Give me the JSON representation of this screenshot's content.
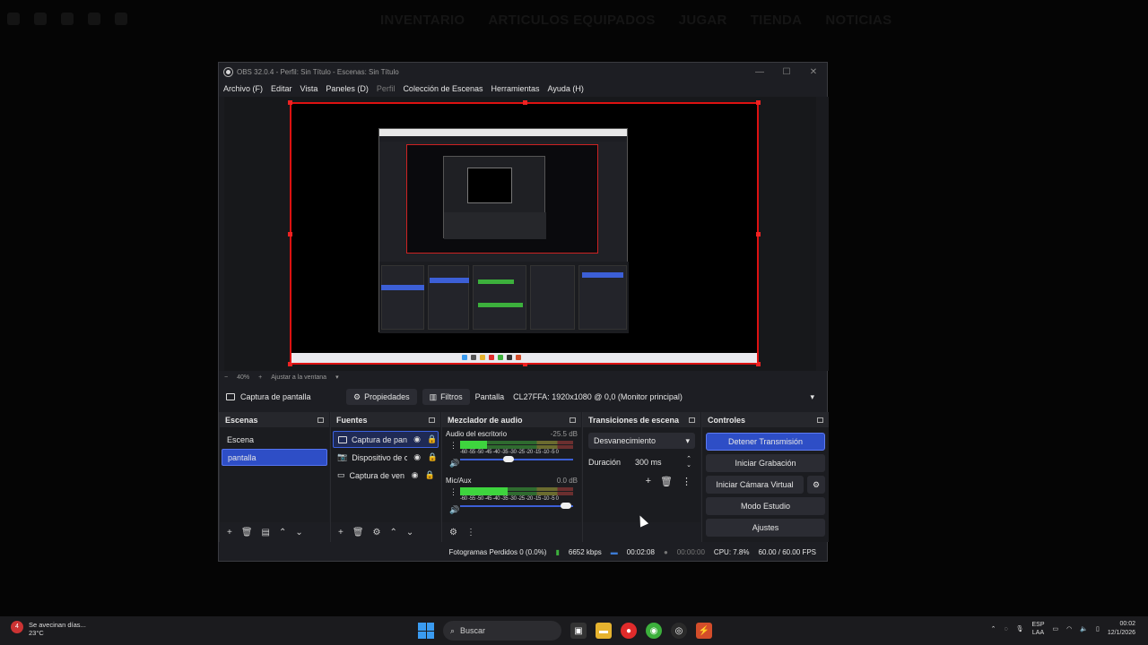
{
  "background": {
    "nav_links": [
      "INVENTARIO",
      "ARTICULOS EQUIPADOS",
      "JUGAR",
      "TIENDA",
      "NOTICIAS"
    ]
  },
  "window": {
    "title": "OBS 32.0.4 - Perfil: Sin Título - Escenas: Sin Título",
    "controls": {
      "minimize": "—",
      "maximize": "☐",
      "close": "✕"
    }
  },
  "menu": [
    "Archivo (F)",
    "Editar",
    "Vista",
    "Paneles (D)",
    "Perfil",
    "Colección de Escenas",
    "Herramientas",
    "Ayuda (H)"
  ],
  "zoom": {
    "minus": "−",
    "level": "40%",
    "plus": "+",
    "fit": "Ajustar a la ventana",
    "arrow": "▾"
  },
  "source_bar": {
    "name": "Captura de pantalla",
    "properties": "Propiedades",
    "filters": "Filtros",
    "screen_label": "Pantalla",
    "screen_value": "CL27FFA: 1920x1080 @ 0,0 (Monitor principal)"
  },
  "scenes": {
    "title": "Escenas",
    "items": [
      {
        "label": "Escena",
        "selected": false
      },
      {
        "label": "pantalla",
        "selected": true
      }
    ]
  },
  "sources": {
    "title": "Fuentes",
    "items": [
      {
        "label": "Captura de pan",
        "icon": "monitor-icon",
        "selected": true
      },
      {
        "label": "Dispositivo de c",
        "icon": "camera-icon",
        "selected": false
      },
      {
        "label": "Captura de ven",
        "icon": "window-icon",
        "selected": false
      }
    ]
  },
  "mixer": {
    "title": "Mezclador de audio",
    "tracks": [
      {
        "name": "Audio del escritorio",
        "db": "-25.5 dB",
        "level": 0.24,
        "volume": 0.42
      },
      {
        "name": "Mic/Aux",
        "db": "0.0 dB",
        "level": 0.42,
        "volume": 0.98
      }
    ],
    "ticks": "-60 -55 -50 -45 -40 -35 -30 -25 -20 -15 -10 -5 0"
  },
  "transitions": {
    "title": "Transiciones de escena",
    "selected": "Desvanecimiento",
    "duration_label": "Duración",
    "duration_value": "300 ms"
  },
  "controls": {
    "title": "Controles",
    "stop_stream": "Detener Transmisión",
    "start_recording": "Iniciar Grabación",
    "start_virtual_cam": "Iniciar Cámara Virtual",
    "studio_mode": "Modo Estudio",
    "settings": "Ajustes"
  },
  "status": {
    "dropped": "Fotogramas Perdidos 0 (0.0%)",
    "kbps": "6652 kbps",
    "stream_time": "00:02:08",
    "rec_time": "00:00:00",
    "cpu": "CPU: 7.8%",
    "fps": "60.00 / 60.00 FPS"
  },
  "taskbar": {
    "weather_text": "Se avecinan días...",
    "weather_temp": "23°C",
    "weather_badge": "4",
    "search_placeholder": "Buscar",
    "lang_top": "ESP",
    "lang_bottom": "LAA",
    "time": "00:02",
    "date": "12/1/2026"
  }
}
